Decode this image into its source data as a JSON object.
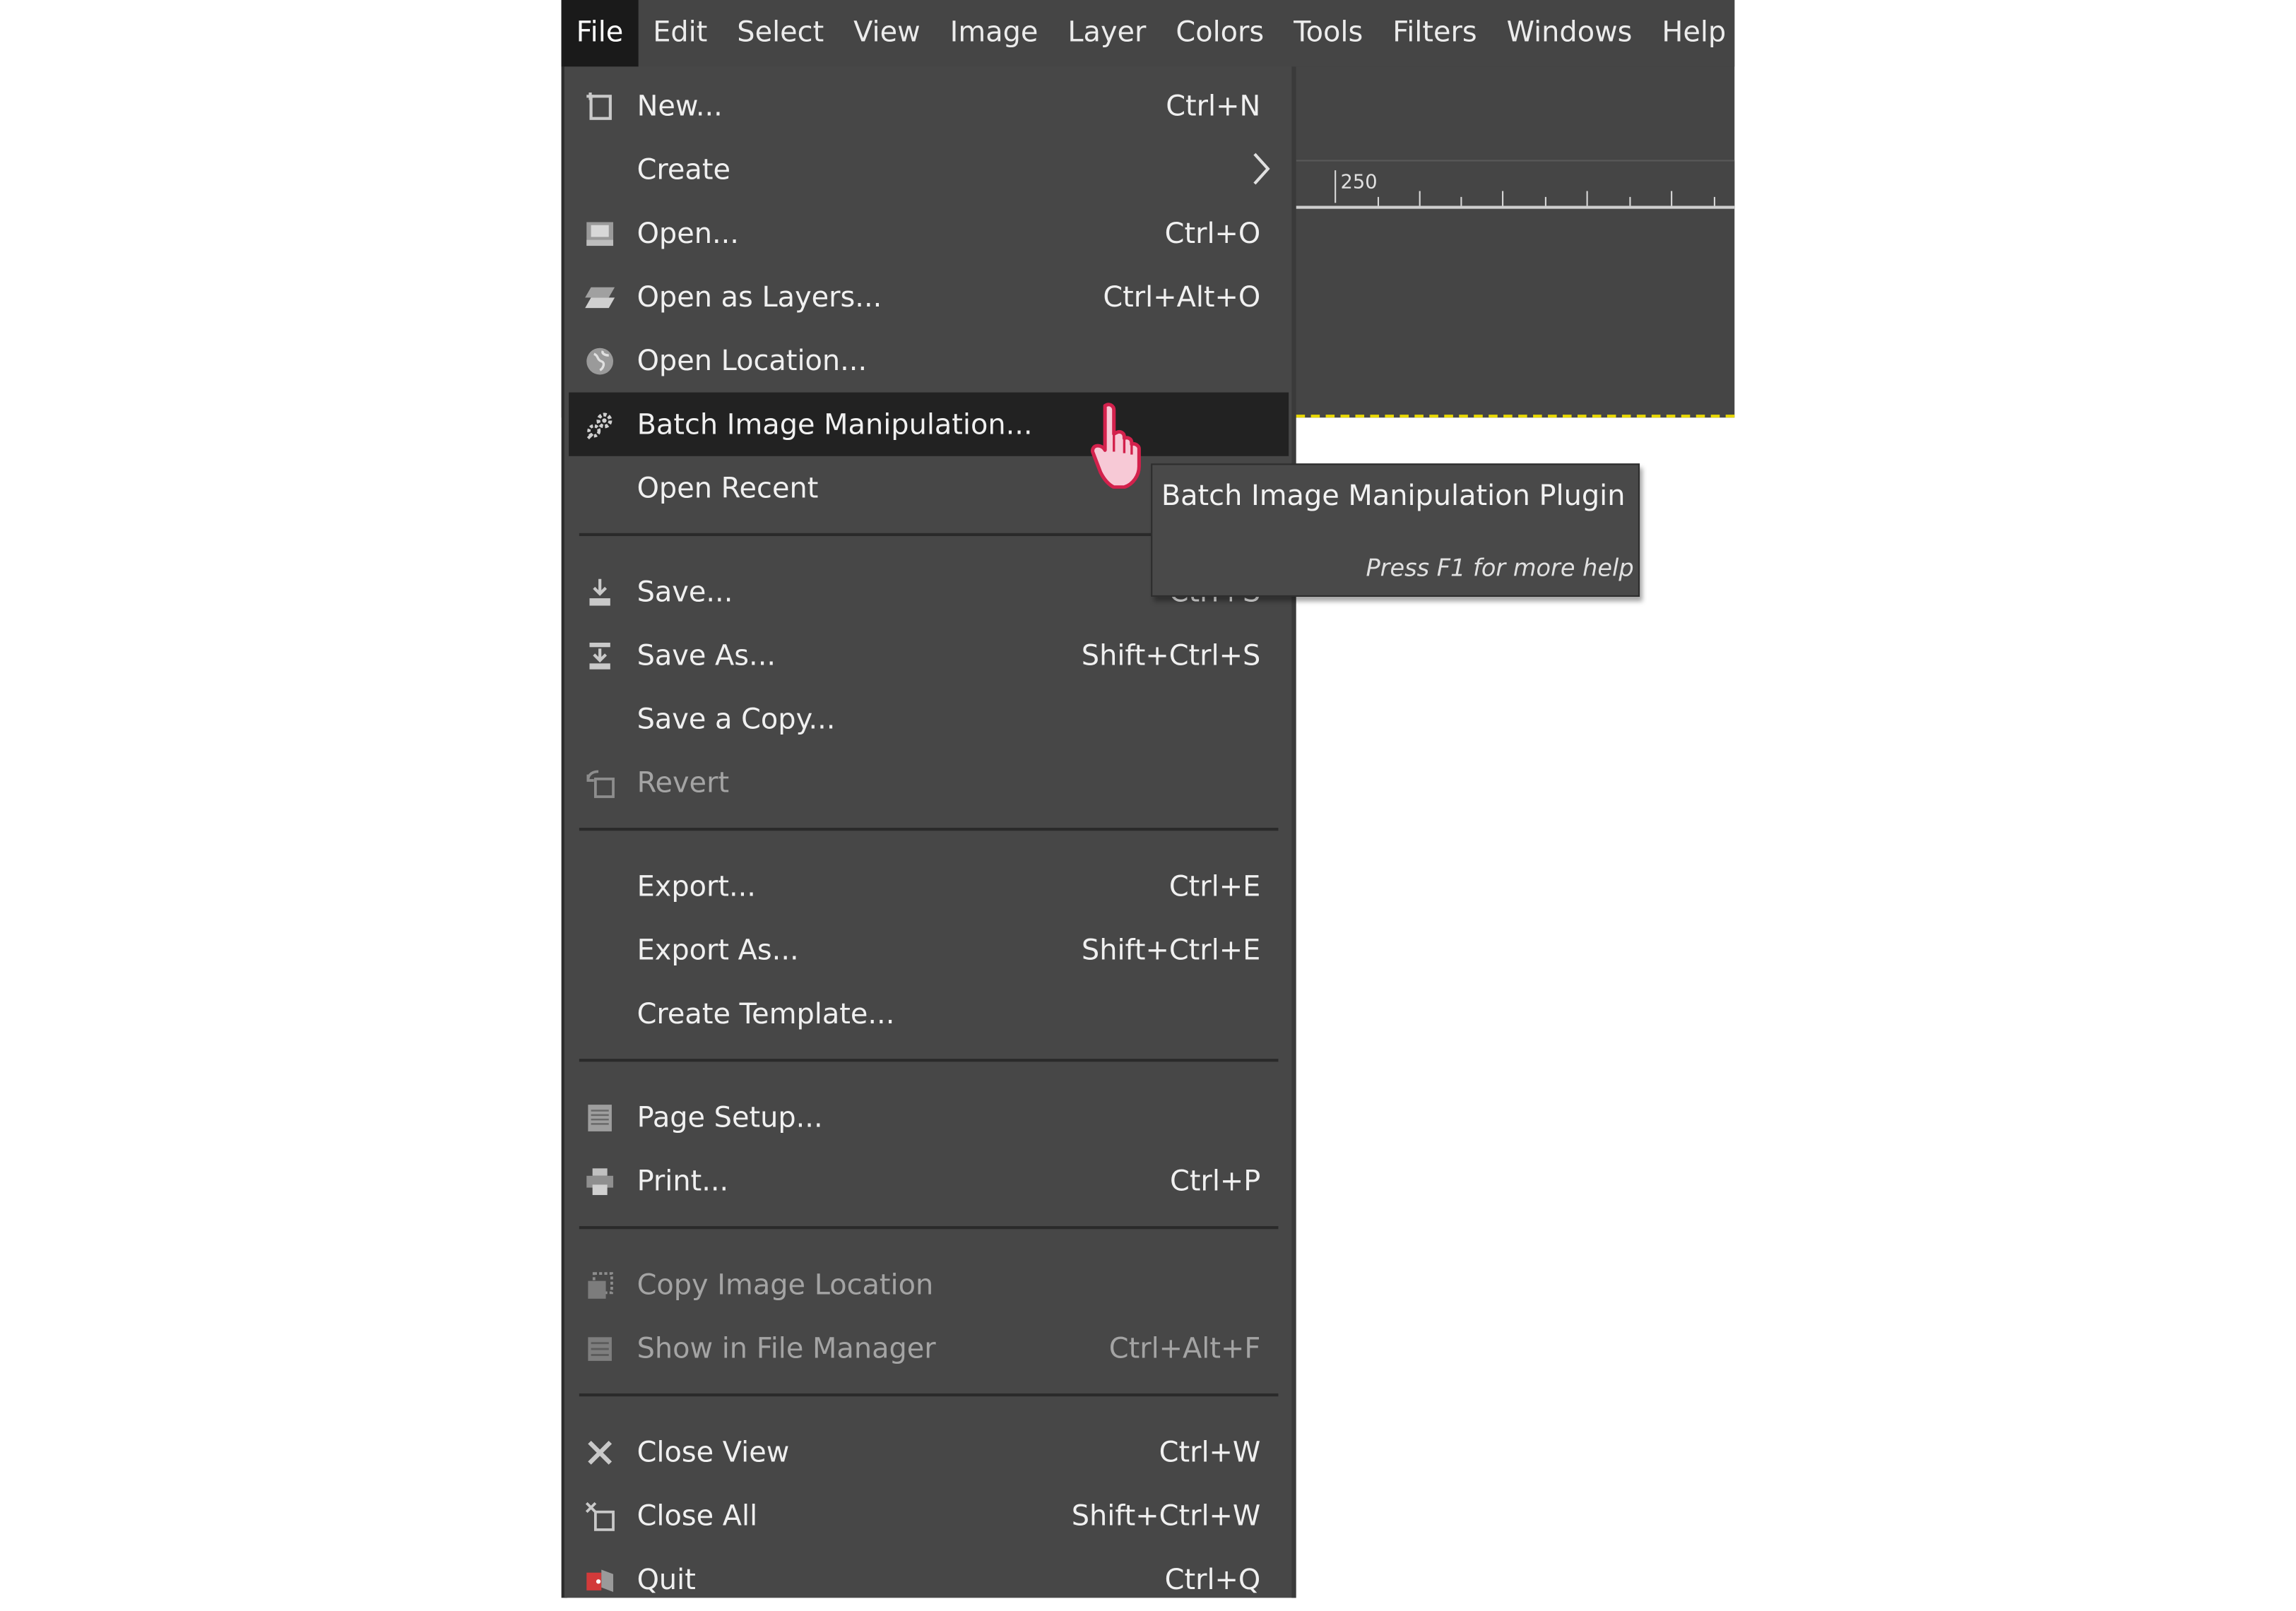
{
  "menubar": {
    "items": [
      {
        "label": "File"
      },
      {
        "label": "Edit"
      },
      {
        "label": "Select"
      },
      {
        "label": "View"
      },
      {
        "label": "Image"
      },
      {
        "label": "Layer"
      },
      {
        "label": "Colors"
      },
      {
        "label": "Tools"
      },
      {
        "label": "Filters"
      },
      {
        "label": "Windows"
      },
      {
        "label": "Help"
      }
    ],
    "active": "File"
  },
  "ruler": {
    "label": "250"
  },
  "file_menu": {
    "items": [
      {
        "label": "New...",
        "shortcut": "Ctrl+N",
        "icon": "new-image-icon"
      },
      {
        "label": "Create",
        "icon": "none",
        "submenu": true
      },
      {
        "label": "Open...",
        "shortcut": "Ctrl+O",
        "icon": "open-icon"
      },
      {
        "label": "Open as Layers...",
        "shortcut": "Ctrl+Alt+O",
        "icon": "open-layers-icon"
      },
      {
        "label": "Open Location...",
        "icon": "globe-icon"
      },
      {
        "label": "Batch Image Manipulation...",
        "icon": "gears-icon",
        "highlighted": true
      },
      {
        "label": "Open Recent",
        "icon": "none",
        "submenu": true
      },
      {
        "label": "Save...",
        "shortcut": "Ctrl+S",
        "icon": "save-icon"
      },
      {
        "label": "Save As...",
        "shortcut": "Shift+Ctrl+S",
        "icon": "save-as-icon"
      },
      {
        "label": "Save a Copy...",
        "icon": "none"
      },
      {
        "label": "Revert",
        "icon": "revert-icon",
        "disabled": true
      },
      {
        "label": "Export...",
        "shortcut": "Ctrl+E",
        "icon": "none"
      },
      {
        "label": "Export As...",
        "shortcut": "Shift+Ctrl+E",
        "icon": "none"
      },
      {
        "label": "Create Template...",
        "icon": "none"
      },
      {
        "label": "Page Setup...",
        "icon": "page-setup-icon"
      },
      {
        "label": "Print...",
        "shortcut": "Ctrl+P",
        "icon": "printer-icon"
      },
      {
        "label": "Copy Image Location",
        "icon": "copy-location-icon",
        "disabled": true
      },
      {
        "label": "Show in File Manager",
        "shortcut": "Ctrl+Alt+F",
        "icon": "file-manager-icon",
        "disabled": true
      },
      {
        "label": "Close View",
        "shortcut": "Ctrl+W",
        "icon": "close-icon"
      },
      {
        "label": "Close All",
        "shortcut": "Shift+Ctrl+W",
        "icon": "close-all-icon"
      },
      {
        "label": "Quit",
        "shortcut": "Ctrl+Q",
        "icon": "quit-icon"
      }
    ]
  },
  "tooltip": {
    "title": "Batch Image Manipulation Plugin",
    "help": "Press F1 for more help"
  },
  "colors": {
    "menu_bg": "#474747",
    "highlight_bg": "#222222",
    "text": "#f0f0f0",
    "disabled_text": "#a4a4a4",
    "canvas_border": "#e8d800"
  }
}
